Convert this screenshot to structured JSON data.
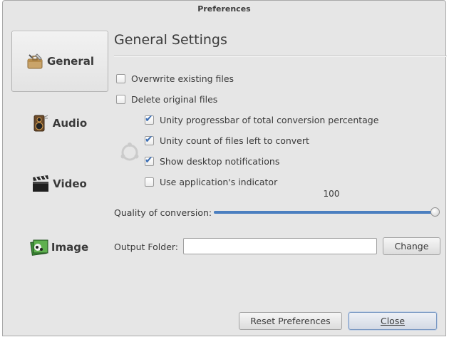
{
  "window": {
    "title": "Preferences"
  },
  "sidebar": {
    "items": [
      {
        "label": "General",
        "icon": "toolbox-icon",
        "active": true
      },
      {
        "label": "Audio",
        "icon": "speaker-icon",
        "active": false
      },
      {
        "label": "Video",
        "icon": "clapperboard-icon",
        "active": false
      },
      {
        "label": "Image",
        "icon": "picture-icon",
        "active": false
      }
    ]
  },
  "main": {
    "heading": "General Settings",
    "options": [
      {
        "label": "Overwrite existing files",
        "checked": false
      },
      {
        "label": "Delete original files",
        "checked": false
      },
      {
        "label": "Unity progressbar of total conversion percentage",
        "checked": true
      },
      {
        "label": "Unity count of files left to convert",
        "checked": true
      },
      {
        "label": "Show desktop notifications",
        "checked": true
      },
      {
        "label": "Use application's indicator",
        "checked": false
      }
    ],
    "quality": {
      "label": "Quality of conversion:",
      "value": "100",
      "fraction": 1.0
    },
    "output_folder": {
      "label": "Output Folder:",
      "value": "",
      "placeholder": ""
    },
    "change_button": "Change"
  },
  "footer": {
    "reset_button": "Reset Preferences",
    "close_button": "Close"
  },
  "colors": {
    "accent": "#4b7fc0",
    "window_bg": "#e6e6e6"
  }
}
